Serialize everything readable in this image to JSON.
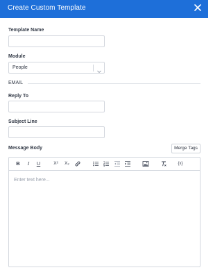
{
  "header": {
    "title": "Create Custom Template"
  },
  "template_name": {
    "label": "Template Name",
    "value": ""
  },
  "module": {
    "label": "Module",
    "selected": "People"
  },
  "email_section": {
    "label": "EMAIL"
  },
  "reply_to": {
    "label": "Reply To",
    "value": ""
  },
  "subject_line": {
    "label": "Subject Line",
    "value": ""
  },
  "message_body": {
    "label": "Message Body",
    "merge_tags_label": "Merge Tags",
    "placeholder": "Enter text here...",
    "toolbar": {
      "bold": "B",
      "italic": "I",
      "underline": "U",
      "superscript": "X²",
      "subscript": "X₂",
      "variable": "{x}"
    }
  },
  "colors": {
    "header_bg": "#1e6fd9",
    "border": "#d3d7de",
    "text": "#2d3340"
  }
}
